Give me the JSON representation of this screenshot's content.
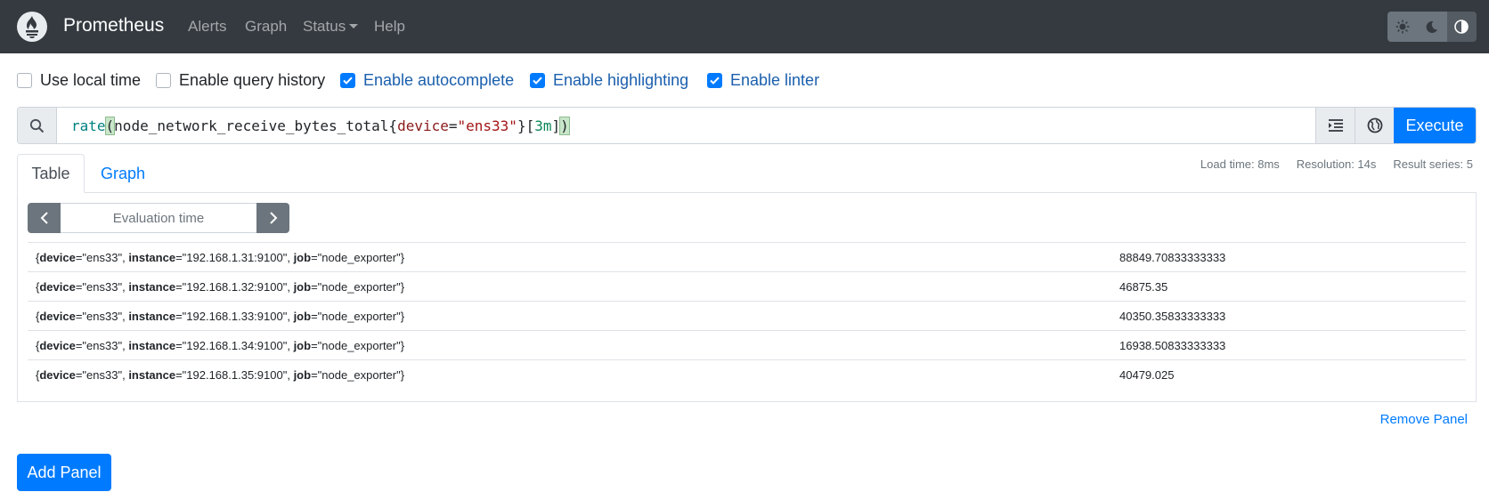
{
  "navbar": {
    "brand": "Prometheus",
    "links": [
      {
        "label": "Alerts"
      },
      {
        "label": "Graph"
      },
      {
        "label": "Status"
      },
      {
        "label": "Help"
      }
    ],
    "theme_buttons": [
      "sun-icon",
      "moon-icon",
      "contrast-icon"
    ]
  },
  "options": [
    {
      "label": "Use local time",
      "checked": false
    },
    {
      "label": "Enable query history",
      "checked": false
    },
    {
      "label": "Enable autocomplete",
      "checked": true
    },
    {
      "label": "Enable highlighting",
      "checked": true
    },
    {
      "label": "Enable linter",
      "checked": true
    }
  ],
  "query": {
    "fn": "rate",
    "open_paren": "(",
    "metric": "node_network_receive_bytes_total",
    "open_brace": "{",
    "label": "device",
    "eq": "=",
    "label_value": "\"ens33\"",
    "close_brace": "}",
    "range_open": "[",
    "duration": "3m",
    "range_close": "]",
    "close_paren": ")",
    "execute_label": "Execute"
  },
  "tabs": {
    "table": "Table",
    "graph": "Graph"
  },
  "stats": {
    "load_time": "Load time: 8ms",
    "resolution": "Resolution: 14s",
    "result_series": "Result series: 5"
  },
  "panel": {
    "eval_placeholder": "Evaluation time",
    "results": [
      {
        "instance": "\"192.168.1.31:9100\"",
        "value": "88849.70833333333"
      },
      {
        "instance": "\"192.168.1.32:9100\"",
        "value": "46875.35"
      },
      {
        "instance": "\"192.168.1.33:9100\"",
        "value": "40350.35833333333"
      },
      {
        "instance": "\"192.168.1.34:9100\"",
        "value": "16938.50833333333"
      },
      {
        "instance": "\"192.168.1.35:9100\"",
        "value": "40479.025"
      }
    ],
    "label_device": "device",
    "label_device_value": "\"ens33\"",
    "label_instance": "instance",
    "label_job": "job",
    "label_job_value": "\"node_exporter\"",
    "remove_label": "Remove Panel"
  },
  "add_panel_label": "Add Panel",
  "colors": {
    "navbar": "#343a40",
    "primary": "#007bff"
  }
}
